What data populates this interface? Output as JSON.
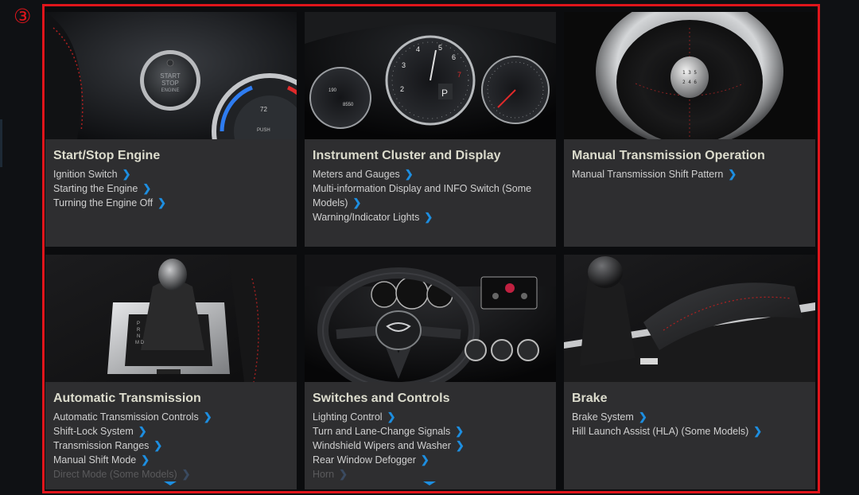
{
  "marker": "③",
  "cards": [
    {
      "title": "Start/Stop Engine",
      "photo": "start-stop-button-photo",
      "links": [
        {
          "label": "Ignition Switch"
        },
        {
          "label": "Starting the Engine"
        },
        {
          "label": "Turning the Engine Off"
        }
      ]
    },
    {
      "title": "Instrument Cluster and Display",
      "photo": "instrument-cluster-photo",
      "links": [
        {
          "label": "Meters and Gauges"
        },
        {
          "label": "Multi-information Display and INFO Switch (Some Models)"
        },
        {
          "label": "Warning/Indicator Lights"
        }
      ]
    },
    {
      "title": "Manual Transmission Operation",
      "photo": "manual-shift-knob-photo",
      "links": [
        {
          "label": "Manual Transmission Shift Pattern"
        }
      ]
    },
    {
      "title": "Automatic Transmission",
      "photo": "automatic-shifter-photo",
      "links": [
        {
          "label": "Automatic Transmission Controls"
        },
        {
          "label": "Shift-Lock System"
        },
        {
          "label": "Transmission Ranges"
        },
        {
          "label": "Manual Shift Mode"
        },
        {
          "label": "Direct Mode (Some Models)"
        }
      ],
      "has_more": true
    },
    {
      "title": "Switches and Controls",
      "photo": "steering-dashboard-photo",
      "links": [
        {
          "label": "Lighting Control"
        },
        {
          "label": "Turn and Lane-Change Signals"
        },
        {
          "label": "Windshield Wipers and Washer"
        },
        {
          "label": "Rear Window Defogger"
        },
        {
          "label": "Horn"
        }
      ],
      "has_more": true
    },
    {
      "title": "Brake",
      "photo": "parking-brake-photo",
      "links": [
        {
          "label": "Brake System"
        },
        {
          "label": "Hill Launch Assist (HLA) (Some Models)"
        }
      ]
    }
  ],
  "photo_text": {
    "start_button": [
      "START",
      "STOP",
      "ENGINE"
    ],
    "knob_value": "72",
    "knob_push": "PUSH",
    "gear": "P",
    "range": "190",
    "odo": "8550"
  }
}
